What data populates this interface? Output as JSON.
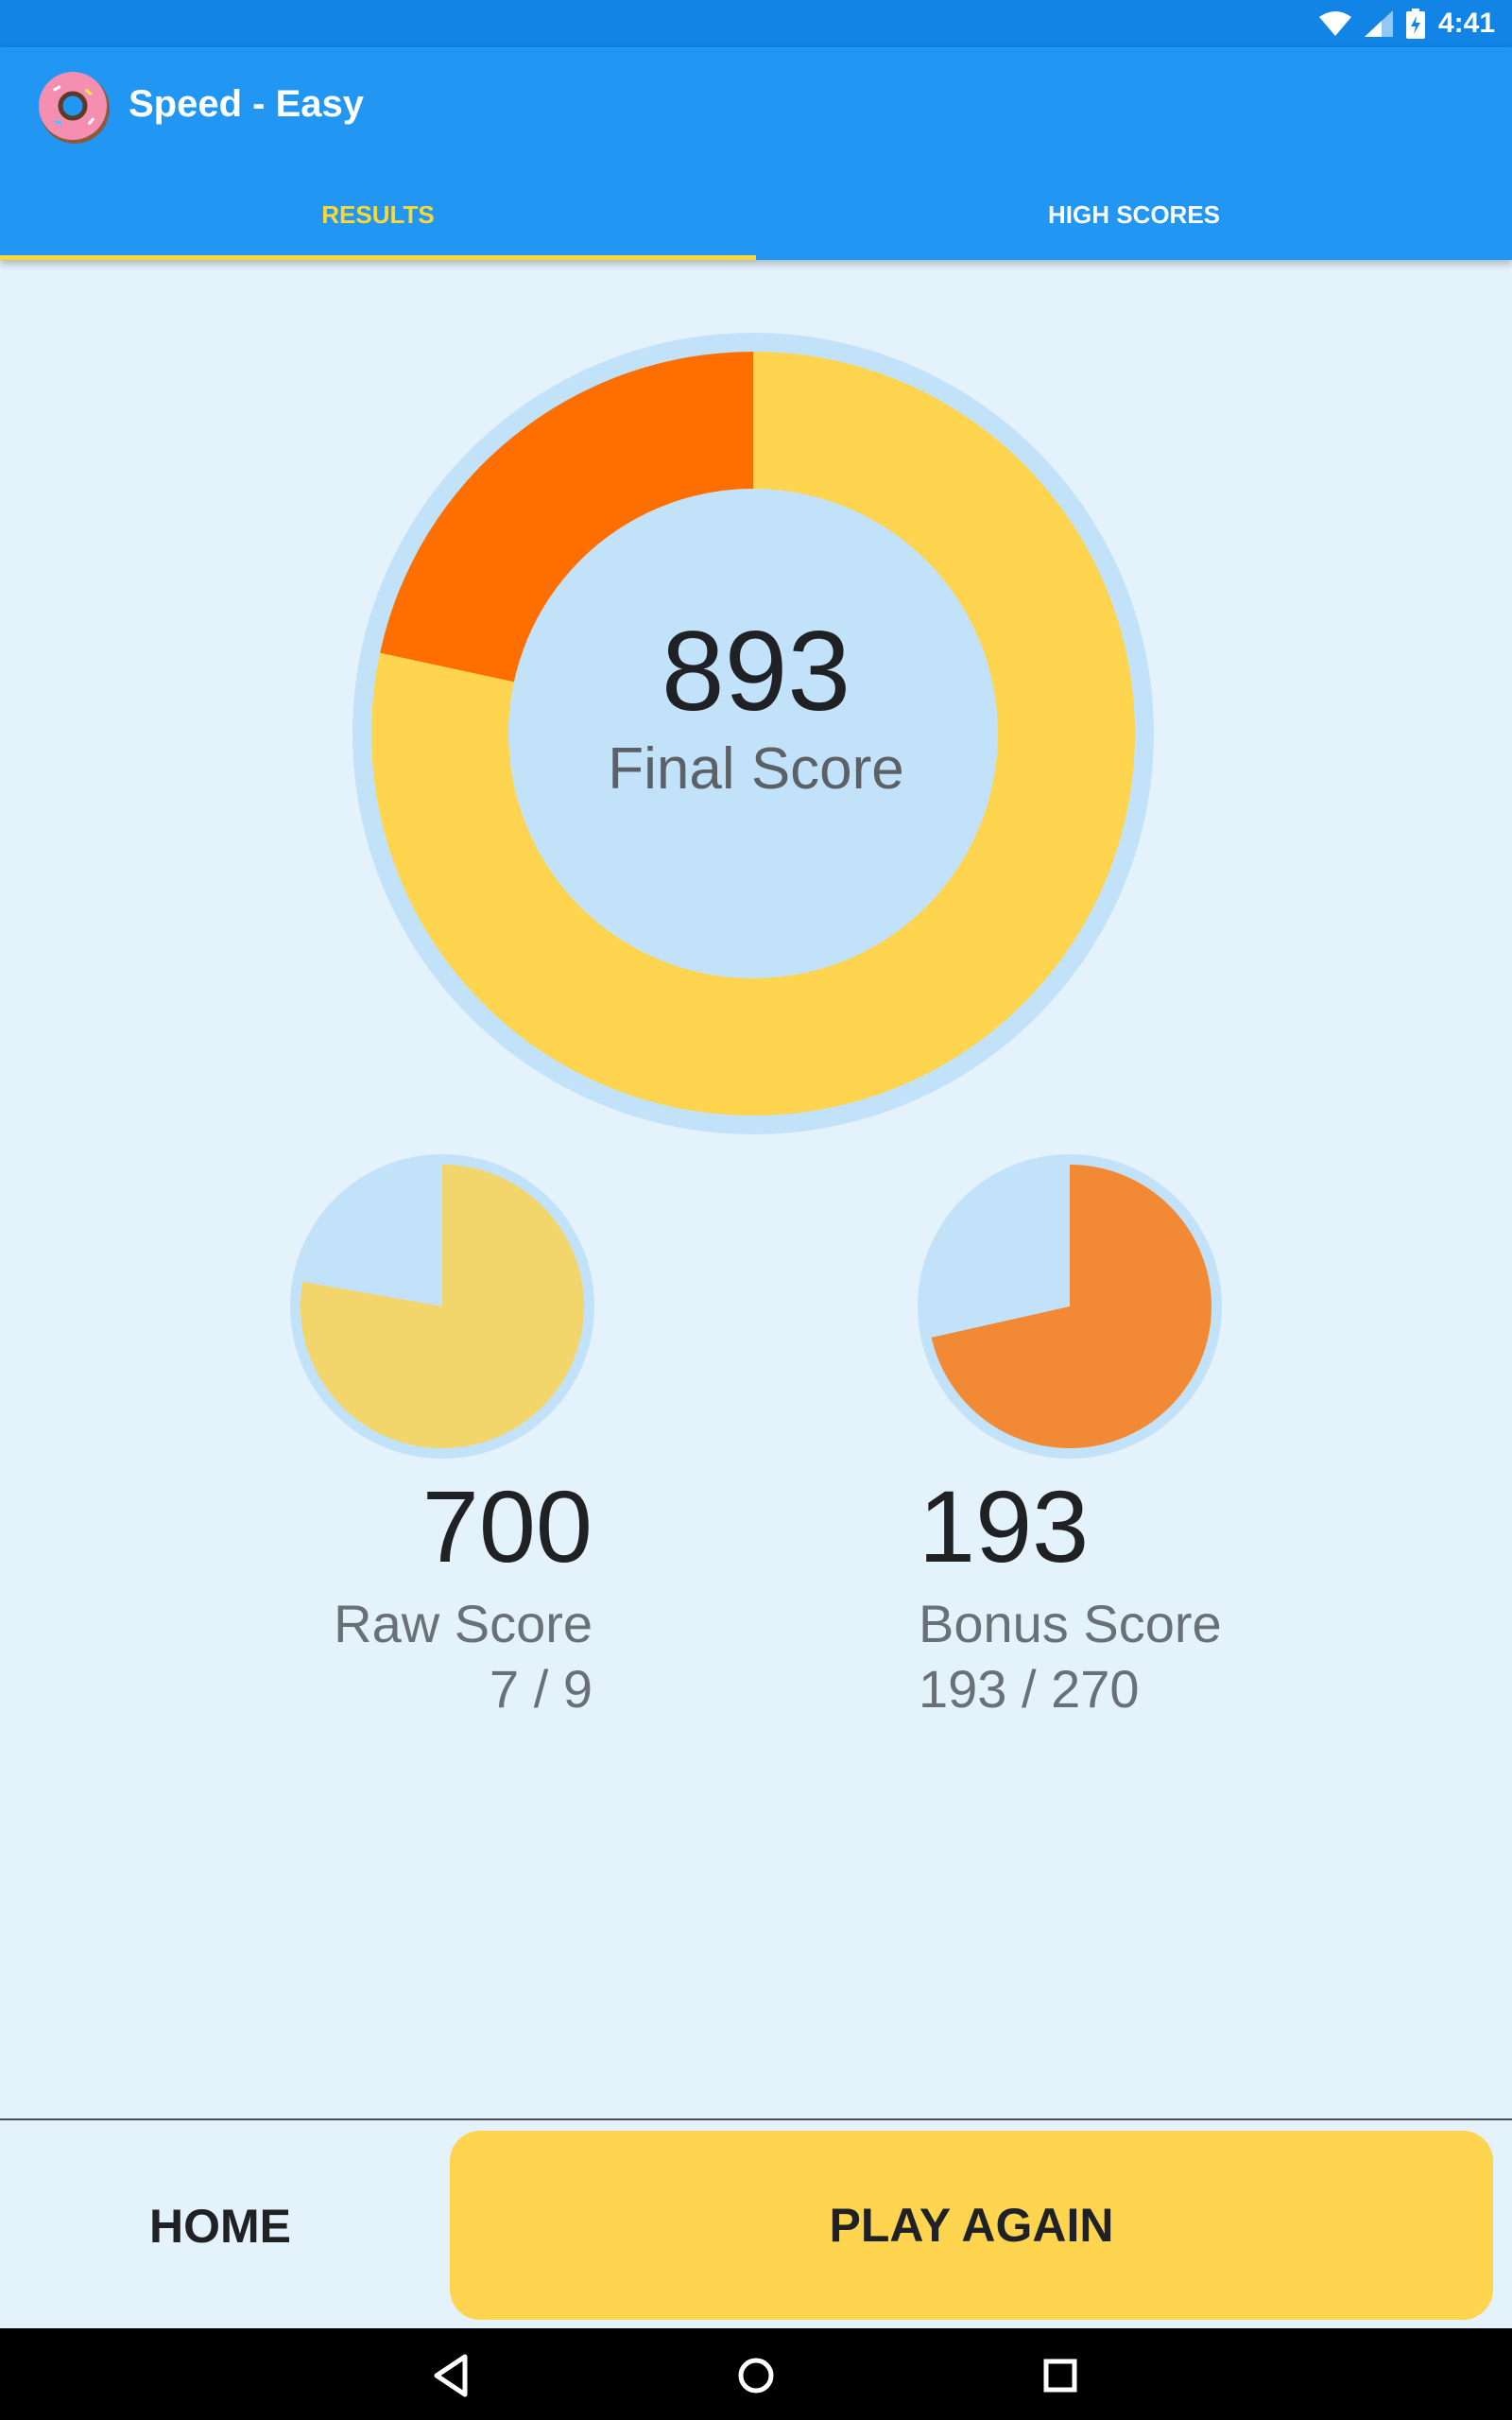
{
  "status_bar": {
    "time": "4:41",
    "icons": [
      "wifi-icon",
      "signal-icon",
      "battery-charging-icon"
    ]
  },
  "app_bar": {
    "title": "Speed - Easy",
    "logo_icon": "donut-icon"
  },
  "tabs": [
    {
      "label": "RESULTS",
      "selected": true
    },
    {
      "label": "HIGH SCORES",
      "selected": false
    }
  ],
  "final_score": {
    "value": "893",
    "label": "Final Score",
    "segments": [
      {
        "name": "raw",
        "value": 700,
        "color": "#ffd54f"
      },
      {
        "name": "bonus",
        "value": 193,
        "color": "#ff6f00"
      }
    ]
  },
  "raw_score": {
    "value": "700",
    "label": "Raw Score",
    "ratio": "7 / 9",
    "fraction": 0.7778,
    "color": "#f2d66b"
  },
  "bonus_score": {
    "value": "193",
    "label": "Bonus Score",
    "ratio": "193 / 270",
    "fraction": 0.7148,
    "color": "#f28a35"
  },
  "buttons": {
    "home": "HOME",
    "play_again": "PLAY AGAIN"
  },
  "colors": {
    "app_bar": "#2296f3",
    "status_bar": "#1184e6",
    "accent": "#fdd835",
    "background": "#e4f2fc",
    "chart_track": "#c2e2f9"
  },
  "nav_bar": {
    "icons": [
      "back-icon",
      "home-icon",
      "recents-icon"
    ]
  }
}
